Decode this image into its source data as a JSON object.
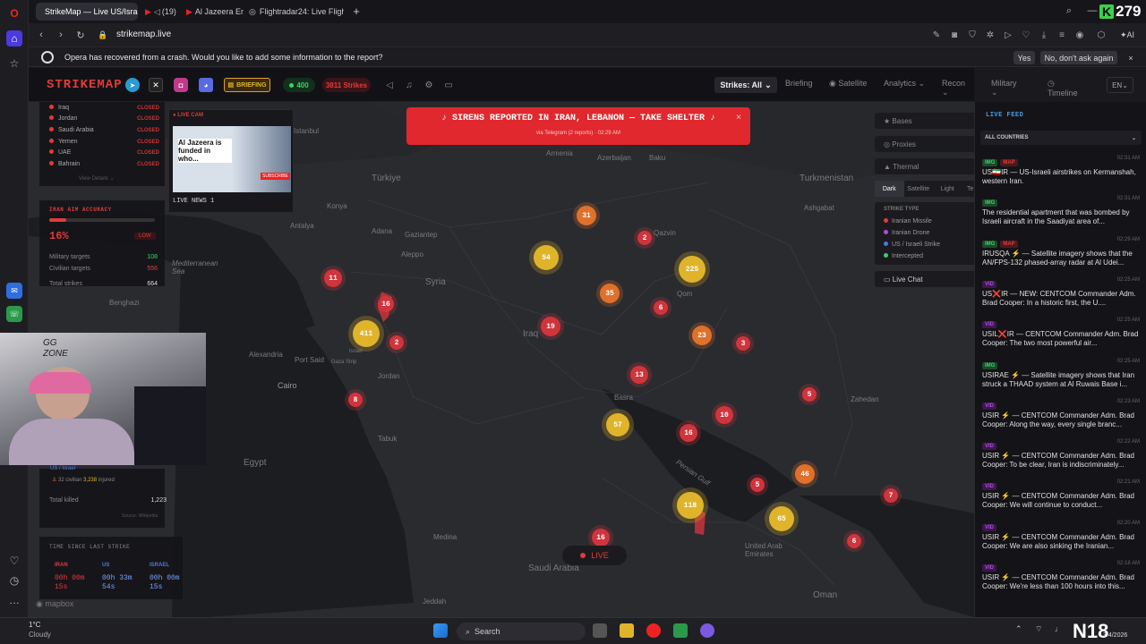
{
  "browser": {
    "tabs": [
      {
        "label": "StrikeMap — Live US/Israel"
      },
      {
        "label": "(19)"
      },
      {
        "label": "Al Jazeera Eng"
      },
      {
        "label": "Flightradar24: Live Flight T"
      }
    ],
    "new_tab": "+",
    "url": "strikemap.live",
    "counter": "279",
    "infobar": {
      "message": "Opera has recovered from a crash. Would you like to add some information to the report?",
      "yes": "Yes",
      "no": "No, don't ask again"
    }
  },
  "app": {
    "logo": "STRIKEMAP",
    "briefing": "BRIEFING",
    "count_green": "400",
    "count_strikes": "3811 Strikes",
    "nav": {
      "strikes": "Strikes: All",
      "briefing": "Briefing",
      "satellite": "Satellite",
      "analytics": "Analytics",
      "recon": "Recon",
      "military": "Military",
      "timeline": "Timeline",
      "lang": "EN"
    }
  },
  "alert": {
    "title": "SIRENS REPORTED IN IRAN, LEBANON — TAKE SHELTER",
    "sub": "via Telegram (2 reports) · 02:29 AM"
  },
  "countries": [
    {
      "name": "Iraq",
      "status": "CLOSED"
    },
    {
      "name": "Jordan",
      "status": "CLOSED"
    },
    {
      "name": "Saudi Arabia",
      "status": "CLOSED"
    },
    {
      "name": "Yemen",
      "status": "CLOSED"
    },
    {
      "name": "UAE",
      "status": "CLOSED"
    },
    {
      "name": "Bahrain",
      "status": "CLOSED"
    }
  ],
  "view_details": "View Details",
  "live_cam": {
    "label": "LIVE CAM",
    "video_caption": "Al Jazeera is funded in who...",
    "channel": "LIVE NEWS 1",
    "subscribe": "SUBSCRIBE"
  },
  "accuracy": {
    "title": "IRAN AIM ACCURACY",
    "percent": "16%",
    "level": "LOW",
    "percent_value": 16,
    "rows": [
      {
        "label": "Military targets",
        "value": "108"
      },
      {
        "label": "Civilian targets",
        "value": "556"
      },
      {
        "label": "Total strikes",
        "value": "664"
      }
    ]
  },
  "casualties": {
    "label_us": "US / Israel",
    "civ": "32",
    "civ_label": "civilian",
    "injured": "3,238",
    "injured_label": "injured",
    "total_label": "Total killed",
    "total": "1,223",
    "source": "Source: Wikipedia"
  },
  "timer": {
    "title": "TIME SINCE LAST STRIKE",
    "iran_label": "IRAN",
    "iran_1": "00h 00m",
    "iran_2": "15s",
    "us_label": "US",
    "us_1": "00h 33m",
    "us_2": "54s",
    "israel_label": "ISRAEL",
    "israel_1": "00h 00m",
    "israel_2": "15s"
  },
  "mapbox": "mapbox",
  "map": {
    "live": "LIVE",
    "places": [
      "Türkiye",
      "Konya",
      "Adana",
      "Gaziantep",
      "Aleppo",
      "Syria",
      "Antalya",
      "Mediterranean Sea",
      "Alexandria",
      "Port Said",
      "Gaza Strip",
      "Cairo",
      "Egypt",
      "Tabuk",
      "Medina",
      "Jeddah",
      "Saudi Arabia",
      "Iraq",
      "Basra",
      "Qazvin",
      "Qom",
      "Baku",
      "Azerbaijan",
      "Armenia",
      "Turkmenistan",
      "Ashgabat",
      "Zahedan",
      "United Arab Emirates",
      "Oman",
      "Persian Gulf",
      "Jordan",
      "Israel",
      "Istanbul",
      "Benghazi"
    ],
    "clusters": [
      "31",
      "2",
      "54",
      "225",
      "35",
      "6",
      "11",
      "16",
      "411",
      "2",
      "19",
      "23",
      "3",
      "13",
      "8",
      "57",
      "10",
      "16",
      "5",
      "46",
      "5",
      "118",
      "65",
      "7",
      "6",
      "16"
    ]
  },
  "layers": {
    "bases": "Bases",
    "proxies": "Proxies",
    "thermal": "Thermal",
    "styles": [
      "Dark",
      "Satellite",
      "Light",
      "Terrain"
    ],
    "strike_type": "STRIKE TYPE",
    "types": [
      {
        "label": "Iranian Missile",
        "color": "#e23a3a"
      },
      {
        "label": "Iranian Drone",
        "color": "#b04ae0"
      },
      {
        "label": "US / Israeli Strike",
        "color": "#4a7ae0"
      },
      {
        "label": "Intercepted",
        "color": "#3ad06a"
      }
    ],
    "live_chat": "Live Chat"
  },
  "feed": {
    "title": "LIVE FEED",
    "filter": "ALL COUNTRIES",
    "items": [
      {
        "tags": [
          "IMG",
          "MAP"
        ],
        "time": "02:31 AM",
        "text": "US🇮🇷IR — US-Israeli airstrikes on Kermanshah, western Iran."
      },
      {
        "tags": [
          "IMG"
        ],
        "time": "02:31 AM",
        "text": "The residential apartment that was bombed by Israeli aircraft in the Saadiyat area of..."
      },
      {
        "tags": [
          "IMG",
          "MAP"
        ],
        "time": "02:29 AM",
        "text": "IRUSQA ⚡ — Satellite imagery shows that the AN/FPS-132 phased-array radar at Al Udei..."
      },
      {
        "tags": [
          "VID"
        ],
        "time": "02:25 AM",
        "text": "US❌IR — NEW: CENTCOM Commander Adm. Brad Cooper: In a historic first, the U...."
      },
      {
        "tags": [
          "VID"
        ],
        "time": "02:25 AM",
        "text": "USIL❌IR — CENTCOM Commander Adm. Brad Cooper: The two most powerful air..."
      },
      {
        "tags": [
          "IMG"
        ],
        "time": "02:25 AM",
        "text": "USIRAE ⚡ — Satellite imagery shows that Iran struck a THAAD system at Al Ruwais Base i..."
      },
      {
        "tags": [
          "VID"
        ],
        "time": "02:23 AM",
        "text": "USIR ⚡ — CENTCOM Commander Adm. Brad Cooper: Along the way, every single branc..."
      },
      {
        "tags": [
          "VID"
        ],
        "time": "02:22 AM",
        "text": "USIR ⚡ — CENTCOM Commander Adm. Brad Cooper: To be clear, Iran is indiscriminately..."
      },
      {
        "tags": [
          "VID"
        ],
        "time": "02:21 AM",
        "text": "USIR ⚡ — CENTCOM Commander Adm. Brad Cooper: We will continue to conduct..."
      },
      {
        "tags": [
          "VID"
        ],
        "time": "02:20 AM",
        "text": "USIR ⚡ — CENTCOM Commander Adm. Brad Cooper: We are also sinking the Iranian..."
      },
      {
        "tags": [
          "VID"
        ],
        "time": "02:18 AM",
        "text": "USIR ⚡ — CENTCOM Commander Adm. Brad Cooper: We're less than 100 hours into this..."
      }
    ]
  },
  "taskbar": {
    "temp": "1°C",
    "weather": "Cloudy",
    "search": "Search",
    "date": "3/4/2026"
  },
  "colors": {
    "accent_red": "#e0282e",
    "cluster_red": "#d0343c",
    "cluster_orange": "#e0702a",
    "cluster_yellow": "#e0b42a",
    "live_green": "#3ad06a"
  }
}
